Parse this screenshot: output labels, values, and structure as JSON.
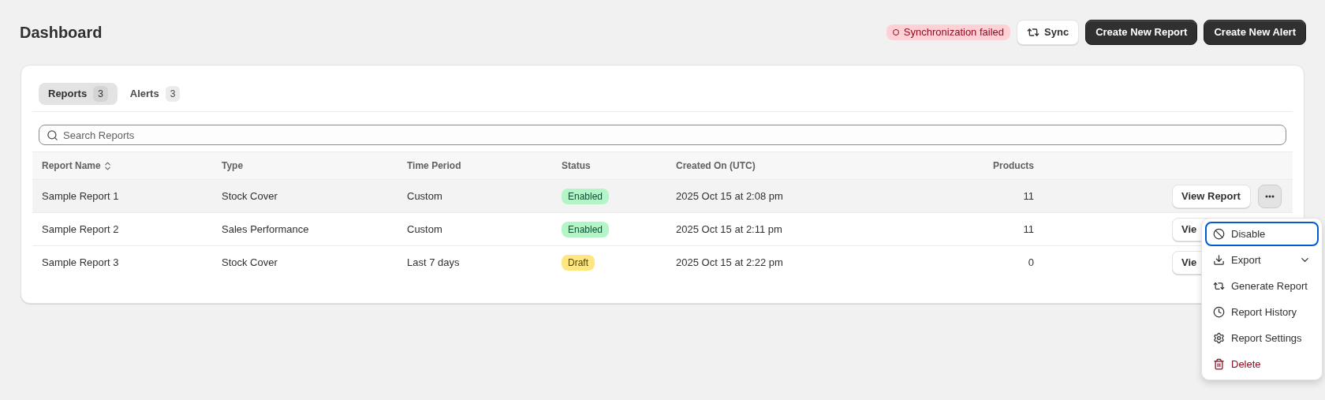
{
  "page": {
    "title": "Dashboard"
  },
  "sync_status": {
    "text": "Synchronization failed",
    "failed": true
  },
  "header_buttons": [
    {
      "label": "Sync",
      "kind": "secondary"
    },
    {
      "label": "Create New Report",
      "kind": "primary"
    },
    {
      "label": "Create New Alert",
      "kind": "primary"
    }
  ],
  "tabs": [
    {
      "label": "Reports",
      "count": "3",
      "selected": true
    },
    {
      "label": "Alerts",
      "count": "3",
      "selected": false
    }
  ],
  "search": {
    "placeholder": "Search Reports"
  },
  "table": {
    "columns": [
      {
        "label": "Report Name",
        "sortable": true
      },
      {
        "label": "Type",
        "sortable": false
      },
      {
        "label": "Time Period",
        "sortable": false
      },
      {
        "label": "Status",
        "sortable": false
      },
      {
        "label": "Created On (UTC)",
        "sortable": false
      },
      {
        "label": "Products",
        "sortable": false
      }
    ],
    "rows": [
      {
        "name": "Sample Report 1",
        "type": "Stock Cover",
        "period": "Custom",
        "status": {
          "label": "Enabled",
          "kind": "enabled"
        },
        "created": "2025 Oct 15 at 2:08 pm",
        "products": "11",
        "action": "View Report",
        "highlighted": true
      },
      {
        "name": "Sample Report 2",
        "type": "Sales Performance",
        "period": "Custom",
        "status": {
          "label": "Enabled",
          "kind": "enabled"
        },
        "created": "2025 Oct 15 at 2:11 pm",
        "products": "11",
        "action": "Vie",
        "highlighted": false
      },
      {
        "name": "Sample Report 3",
        "type": "Stock Cover",
        "period": "Last 7 days",
        "status": {
          "label": "Draft",
          "kind": "draft"
        },
        "created": "2025 Oct 15 at 2:22 pm",
        "products": "0",
        "action": "Vie",
        "highlighted": false
      }
    ]
  },
  "row_menu": [
    {
      "label": "Disable",
      "kind": "normal",
      "selected": true
    },
    {
      "label": "Export",
      "kind": "normal",
      "selected": false,
      "has_submenu": true
    },
    {
      "label": "Generate Report",
      "kind": "normal",
      "selected": false
    },
    {
      "label": "Report History",
      "kind": "normal",
      "selected": false
    },
    {
      "label": "Report Settings",
      "kind": "normal",
      "selected": false
    },
    {
      "label": "Delete",
      "kind": "danger",
      "selected": false
    }
  ]
}
